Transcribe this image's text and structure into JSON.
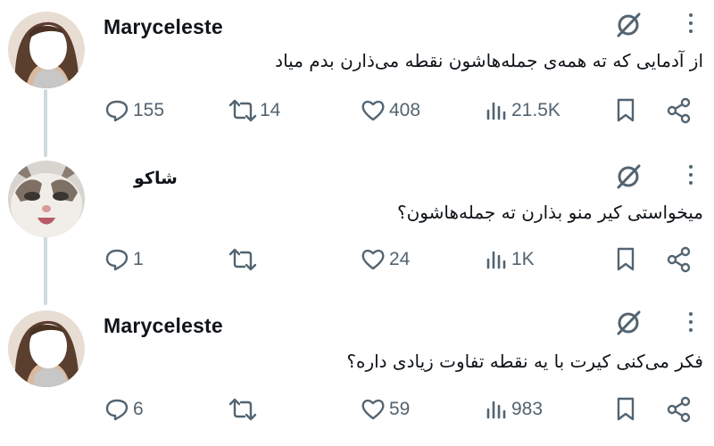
{
  "tweets": [
    {
      "name": "Maryceleste",
      "text": "از آدمایی که ته همه‌ی جمله‌هاشون نقطه می‌ذارن بدم میاد",
      "replies": "155",
      "reposts": "14",
      "likes": "408",
      "views": "21.5K"
    },
    {
      "name": "شاکو",
      "text": "میخواستی کیر منو بذارن ته جمله‌هاشون؟",
      "replies": "1",
      "reposts": "",
      "likes": "24",
      "views": "1K"
    },
    {
      "name": "Maryceleste",
      "text": "فکر می‌کنی کیرت با یه نقطه تفاوت زیادی داره؟",
      "replies": "6",
      "reposts": "",
      "likes": "59",
      "views": "983"
    }
  ],
  "icons": {
    "avatar_1": "woman-profile-photo",
    "avatar_2": "cat-profile-photo",
    "grok": "grok-icon",
    "more": "more-vertical-icon",
    "reply": "reply-icon",
    "repost": "repost-icon",
    "like": "heart-icon",
    "views": "views-icon",
    "bookmark": "bookmark-icon",
    "share": "share-icon"
  },
  "colors": {
    "text": "#0f1419",
    "secondary": "#536471",
    "thread_line": "#cfd9de",
    "background": "#ffffff"
  }
}
